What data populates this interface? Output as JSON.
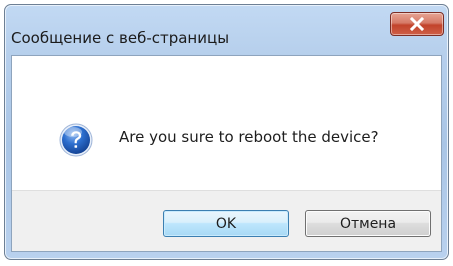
{
  "dialog": {
    "title": "Сообщение с веб-страницы",
    "message": "Are you sure to reboot the device?",
    "icon": "question-icon",
    "close_icon": "close-icon"
  },
  "buttons": {
    "ok_label": "OK",
    "cancel_label": "Отмена"
  },
  "colors": {
    "title_bar": "#b6cfec",
    "close_button": "#c2432b",
    "ok_button_border": "#3c7fb1",
    "button_area": "#f0f0f0"
  }
}
